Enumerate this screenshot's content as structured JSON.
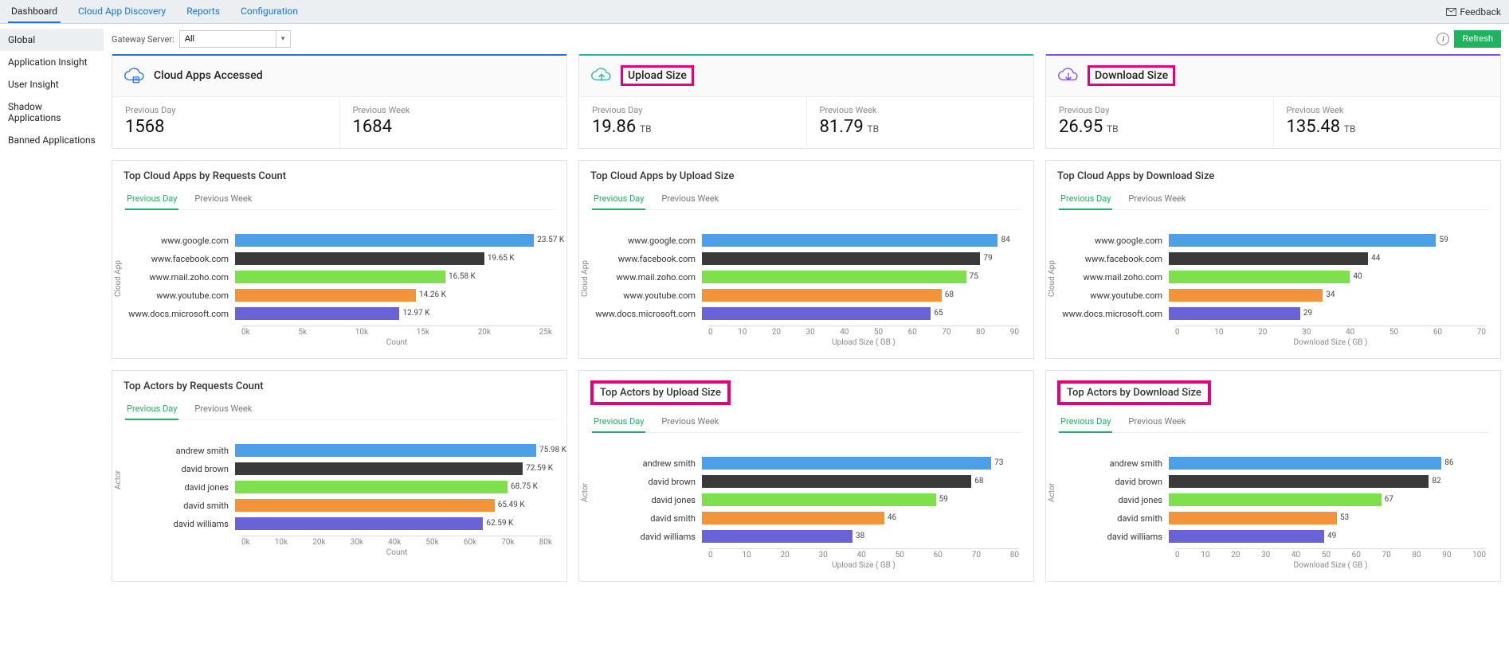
{
  "top_nav": [
    "Dashboard",
    "Cloud App Discovery",
    "Reports",
    "Configuration"
  ],
  "top_nav_active": 0,
  "feedback_label": "Feedback",
  "sidebar_items": [
    "Global",
    "Application Insight",
    "User Insight",
    "Shadow Applications",
    "Banned Applications"
  ],
  "sidebar_active": 0,
  "gateway_label": "Gateway Server:",
  "gateway_value": "All",
  "refresh_label": "Refresh",
  "summary_cards": [
    {
      "title": "Cloud Apps Accessed",
      "accent": "blue",
      "icon": "cloud-apps",
      "stats": [
        {
          "label": "Previous Day",
          "value": "1568",
          "unit": ""
        },
        {
          "label": "Previous Week",
          "value": "1684",
          "unit": ""
        }
      ]
    },
    {
      "title": "Upload Size",
      "accent": "teal",
      "icon": "cloud-up",
      "title_boxed": true,
      "stats": [
        {
          "label": "Previous Day",
          "value": "19.86",
          "unit": "TB"
        },
        {
          "label": "Previous Week",
          "value": "81.79",
          "unit": "TB"
        }
      ]
    },
    {
      "title": "Download Size",
      "accent": "purple",
      "icon": "cloud-down",
      "title_boxed": true,
      "stats": [
        {
          "label": "Previous Day",
          "value": "26.95",
          "unit": "TB"
        },
        {
          "label": "Previous Week",
          "value": "135.48",
          "unit": "TB"
        }
      ]
    }
  ],
  "chart_tabs": [
    "Previous Day",
    "Previous Week"
  ],
  "charts_row1": [
    {
      "title": "Top Cloud Apps by Requests Count",
      "yaxis": "Cloud App",
      "xaxis": "Count"
    },
    {
      "title": "Top Cloud Apps by Upload Size",
      "yaxis": "Cloud App",
      "xaxis": "Upload Size ( GB )"
    },
    {
      "title": "Top Cloud Apps by Download Size",
      "yaxis": "Cloud App",
      "xaxis": "Download Size ( GB )"
    }
  ],
  "charts_row2": [
    {
      "title": "Top Actors by Requests Count",
      "yaxis": "Actor",
      "xaxis": "Count",
      "title_boxed": false
    },
    {
      "title": "Top Actors by Upload Size",
      "yaxis": "Actor",
      "xaxis": "Upload Size ( GB )",
      "title_boxed": true
    },
    {
      "title": "Top Actors by Download Size",
      "yaxis": "Actor",
      "xaxis": "Download Size ( GB )",
      "title_boxed": true
    }
  ],
  "bar_colors": [
    "#4f9fe8",
    "#3a3a3a",
    "#7fe04d",
    "#f2943c",
    "#6a63d6"
  ],
  "chart_data": [
    {
      "type": "bar",
      "title": "Top Cloud Apps by Requests Count",
      "xlabel": "Count",
      "ylabel": "Cloud App",
      "categories": [
        "www.google.com",
        "www.facebook.com",
        "www.mail.zoho.com",
        "www.youtube.com",
        "www.docs.microsoft.com"
      ],
      "values": [
        23570,
        19650,
        16580,
        14260,
        12970
      ],
      "value_labels": [
        "23.57 K",
        "19.65 K",
        "16.58 K",
        "14.26 K",
        "12.97 K"
      ],
      "tick_labels": [
        "0k",
        "5k",
        "10k",
        "15k",
        "20k",
        "25k"
      ],
      "xmax": 25000
    },
    {
      "type": "bar",
      "title": "Top Cloud Apps by Upload Size",
      "xlabel": "Upload Size ( GB )",
      "ylabel": "Cloud App",
      "categories": [
        "www.google.com",
        "www.facebook.com",
        "www.mail.zoho.com",
        "www.youtube.com",
        "www.docs.microsoft.com"
      ],
      "values": [
        84,
        79,
        75,
        68,
        65
      ],
      "value_labels": [
        "84",
        "79",
        "75",
        "68",
        "65"
      ],
      "tick_labels": [
        "0",
        "10",
        "20",
        "30",
        "40",
        "50",
        "60",
        "70",
        "80",
        "90"
      ],
      "xmax": 90
    },
    {
      "type": "bar",
      "title": "Top Cloud Apps by Download Size",
      "xlabel": "Download Size ( GB )",
      "ylabel": "Cloud App",
      "categories": [
        "www.google.com",
        "www.facebook.com",
        "www.mail.zoho.com",
        "www.youtube.com",
        "www.docs.microsoft.com"
      ],
      "values": [
        59,
        44,
        40,
        34,
        29
      ],
      "value_labels": [
        "59",
        "44",
        "40",
        "34",
        "29"
      ],
      "tick_labels": [
        "0",
        "10",
        "20",
        "30",
        "40",
        "50",
        "60",
        "70"
      ],
      "xmax": 70
    },
    {
      "type": "bar",
      "title": "Top Actors by Requests Count",
      "xlabel": "Count",
      "ylabel": "Actor",
      "categories": [
        "andrew smith",
        "david brown",
        "david jones",
        "david smith",
        "david williams"
      ],
      "values": [
        75980,
        72590,
        68750,
        65490,
        62590
      ],
      "value_labels": [
        "75.98 K",
        "72.59 K",
        "68.75 K",
        "65.49 K",
        "62.59 K"
      ],
      "tick_labels": [
        "0k",
        "10k",
        "20k",
        "30k",
        "40k",
        "50k",
        "60k",
        "70k",
        "80k"
      ],
      "xmax": 80000
    },
    {
      "type": "bar",
      "title": "Top Actors by Upload Size",
      "xlabel": "Upload Size ( GB )",
      "ylabel": "Actor",
      "categories": [
        "andrew smith",
        "david brown",
        "david jones",
        "david smith",
        "david williams"
      ],
      "values": [
        73,
        68,
        59,
        46,
        38
      ],
      "value_labels": [
        "73",
        "68",
        "59",
        "46",
        "38"
      ],
      "tick_labels": [
        "0",
        "10",
        "20",
        "30",
        "40",
        "50",
        "60",
        "70",
        "80"
      ],
      "xmax": 80
    },
    {
      "type": "bar",
      "title": "Top Actors by Download Size",
      "xlabel": "Download Size ( GB )",
      "ylabel": "Actor",
      "categories": [
        "andrew smith",
        "david brown",
        "david jones",
        "david smith",
        "david williams"
      ],
      "values": [
        86,
        82,
        67,
        53,
        49
      ],
      "value_labels": [
        "86",
        "82",
        "67",
        "53",
        "49"
      ],
      "tick_labels": [
        "0",
        "10",
        "20",
        "30",
        "40",
        "50",
        "60",
        "70",
        "80",
        "90",
        "100"
      ],
      "xmax": 100
    }
  ]
}
